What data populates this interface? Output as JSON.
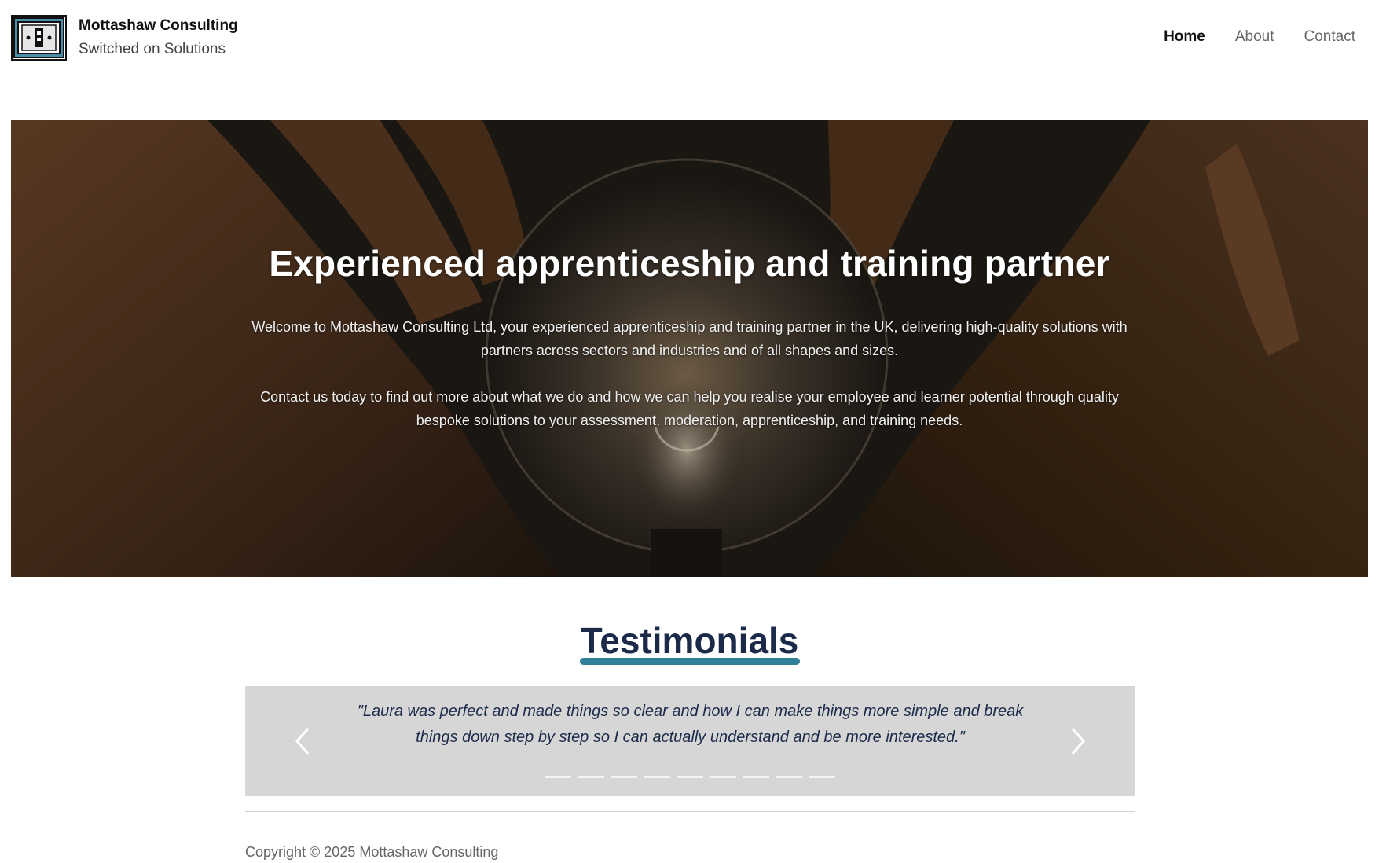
{
  "header": {
    "brand_title": "Mottashaw Consulting",
    "brand_tagline": "Switched on Solutions",
    "nav": [
      {
        "label": "Home",
        "active": true
      },
      {
        "label": "About",
        "active": false
      },
      {
        "label": "Contact",
        "active": false
      }
    ]
  },
  "hero": {
    "title": "Experienced apprenticeship and training partner",
    "paragraph1": "Welcome to Mottashaw Consulting Ltd, your experienced apprenticeship and training partner in the UK, delivering high-quality solutions with partners across sectors and industries and of all shapes and sizes.",
    "paragraph2": "Contact us today to find out more about what we do and how we can help you realise your employee and learner potential through quality bespoke solutions to your assessment, moderation, apprenticeship, and training needs."
  },
  "testimonials": {
    "heading": "Testimonials",
    "quote": "\"Laura was perfect and made things so clear and how I can make things more simple and break things down step by step so I can actually understand and be more interested.\"",
    "slide_count": 9,
    "accent_color": "#2f7f96"
  },
  "footer": {
    "copyright": "Copyright © 2025 Mottashaw Consulting"
  },
  "icons": {
    "logo": "logo-icon",
    "prev": "chevron-left-icon",
    "next": "chevron-right-icon"
  }
}
